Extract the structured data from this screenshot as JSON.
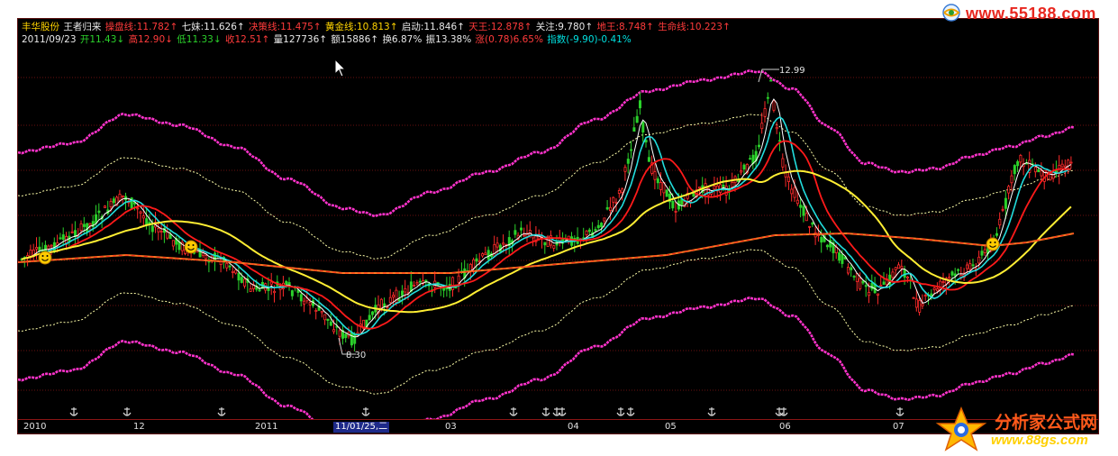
{
  "header": {
    "line1": [
      {
        "text": "丰华股份",
        "color": "yellow"
      },
      {
        "text": "王者归来",
        "color": "white"
      },
      {
        "text": "操盘线:11.782↑",
        "color": "red"
      },
      {
        "text": "七妹:11.626↑",
        "color": "white"
      },
      {
        "text": "决策线:11.475↑",
        "color": "red"
      },
      {
        "text": "黄金线:10.813↑",
        "color": "yellow"
      },
      {
        "text": "启动:11.846↑",
        "color": "white"
      },
      {
        "text": "天王:12.878↑",
        "color": "red"
      },
      {
        "text": "关注:9.780↑",
        "color": "white"
      },
      {
        "text": "地王:8.748↑",
        "color": "red"
      },
      {
        "text": "生命线:10.223↑",
        "color": "red"
      }
    ],
    "line2": [
      {
        "text": "2011/09/23",
        "color": "white"
      },
      {
        "text": "开11.43↓",
        "color": "green"
      },
      {
        "text": "高12.90↓",
        "color": "red"
      },
      {
        "text": "低11.33↓",
        "color": "green"
      },
      {
        "text": "收12.51↑",
        "color": "red"
      },
      {
        "text": "量127736↑",
        "color": "white"
      },
      {
        "text": "额15886↑",
        "color": "white"
      },
      {
        "text": "换6.87%",
        "color": "white"
      },
      {
        "text": "振13.38%",
        "color": "white"
      },
      {
        "text": "涨(0.78)6.65%",
        "color": "red"
      },
      {
        "text": "指数(-9.90)-0.41%",
        "color": "cyan"
      }
    ]
  },
  "annotations": {
    "high_label": "12.99",
    "low_label": "8.30"
  },
  "xaxis": {
    "labels": [
      {
        "text": "2010",
        "highlight": false
      },
      {
        "text": "12",
        "highlight": false
      },
      {
        "text": "2011",
        "highlight": false
      },
      {
        "text": "11/01/25,二",
        "highlight": true
      },
      {
        "text": "03",
        "highlight": false
      },
      {
        "text": "04",
        "highlight": false
      },
      {
        "text": "05",
        "highlight": false
      },
      {
        "text": "06",
        "highlight": false
      },
      {
        "text": "07",
        "highlight": false
      }
    ]
  },
  "watermarks": {
    "top": "www.55188.com",
    "bottom_title": "分析家公式网",
    "bottom_url": "www.88gs.com"
  },
  "colors": {
    "background": "#000000",
    "up_candle": "#ff2a2a",
    "down_candle": "#2bd12b",
    "band_outer": "#ff33cc",
    "band_inner": "#ffffaa",
    "ma_white": "#ffffff",
    "ma_cyan": "#22dddd",
    "ma_red": "#ff1a1a",
    "ma_yellow": "#ffee33",
    "ma_orange": "#ff7a22"
  },
  "icons": [
    "smiley-icon",
    "anchor-icon",
    "mouse-cursor-icon"
  ]
}
